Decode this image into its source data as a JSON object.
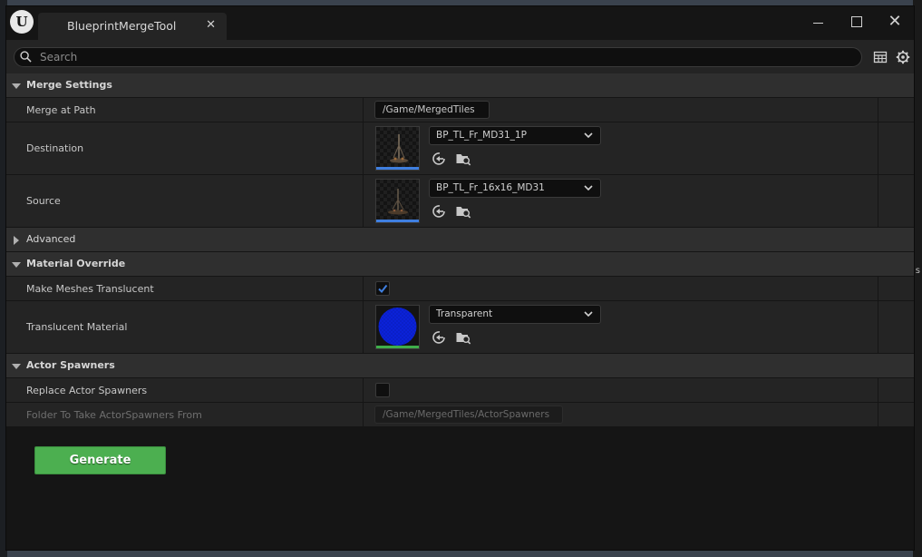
{
  "window": {
    "logo_text": "U",
    "tab_title": "BlueprintMergeTool",
    "close_tab_glyph": "✕",
    "close_window_glyph": "✕"
  },
  "search": {
    "placeholder": "Search"
  },
  "categories": {
    "merge_settings": "Merge Settings",
    "advanced": "Advanced",
    "material_override": "Material Override",
    "actor_spawners": "Actor Spawners"
  },
  "properties": {
    "merge_at_path": {
      "label": "Merge at Path",
      "value": "/Game/MergedTiles"
    },
    "destination": {
      "label": "Destination",
      "asset": "BP_TL_Fr_MD31_1P"
    },
    "source": {
      "label": "Source",
      "asset": "BP_TL_Fr_16x16_MD31"
    },
    "make_meshes_translucent": {
      "label": "Make Meshes Translucent",
      "checked": true
    },
    "translucent_material": {
      "label": "Translucent Material",
      "asset": "Transparent"
    },
    "replace_actor_spawners": {
      "label": "Replace Actor Spawners",
      "checked": false
    },
    "folder_actor_spawners": {
      "label": "Folder To Take ActorSpawners From",
      "value": "/Game/MergedTiles/ActorSpawners"
    }
  },
  "actions": {
    "generate_label": "Generate"
  },
  "colors": {
    "accent_blue": "#3f7fe0",
    "material_green": "#3fae4a",
    "generate_green": "#4caf50",
    "sphere_blue": "#0a1fc8"
  },
  "background_fragment": "s"
}
